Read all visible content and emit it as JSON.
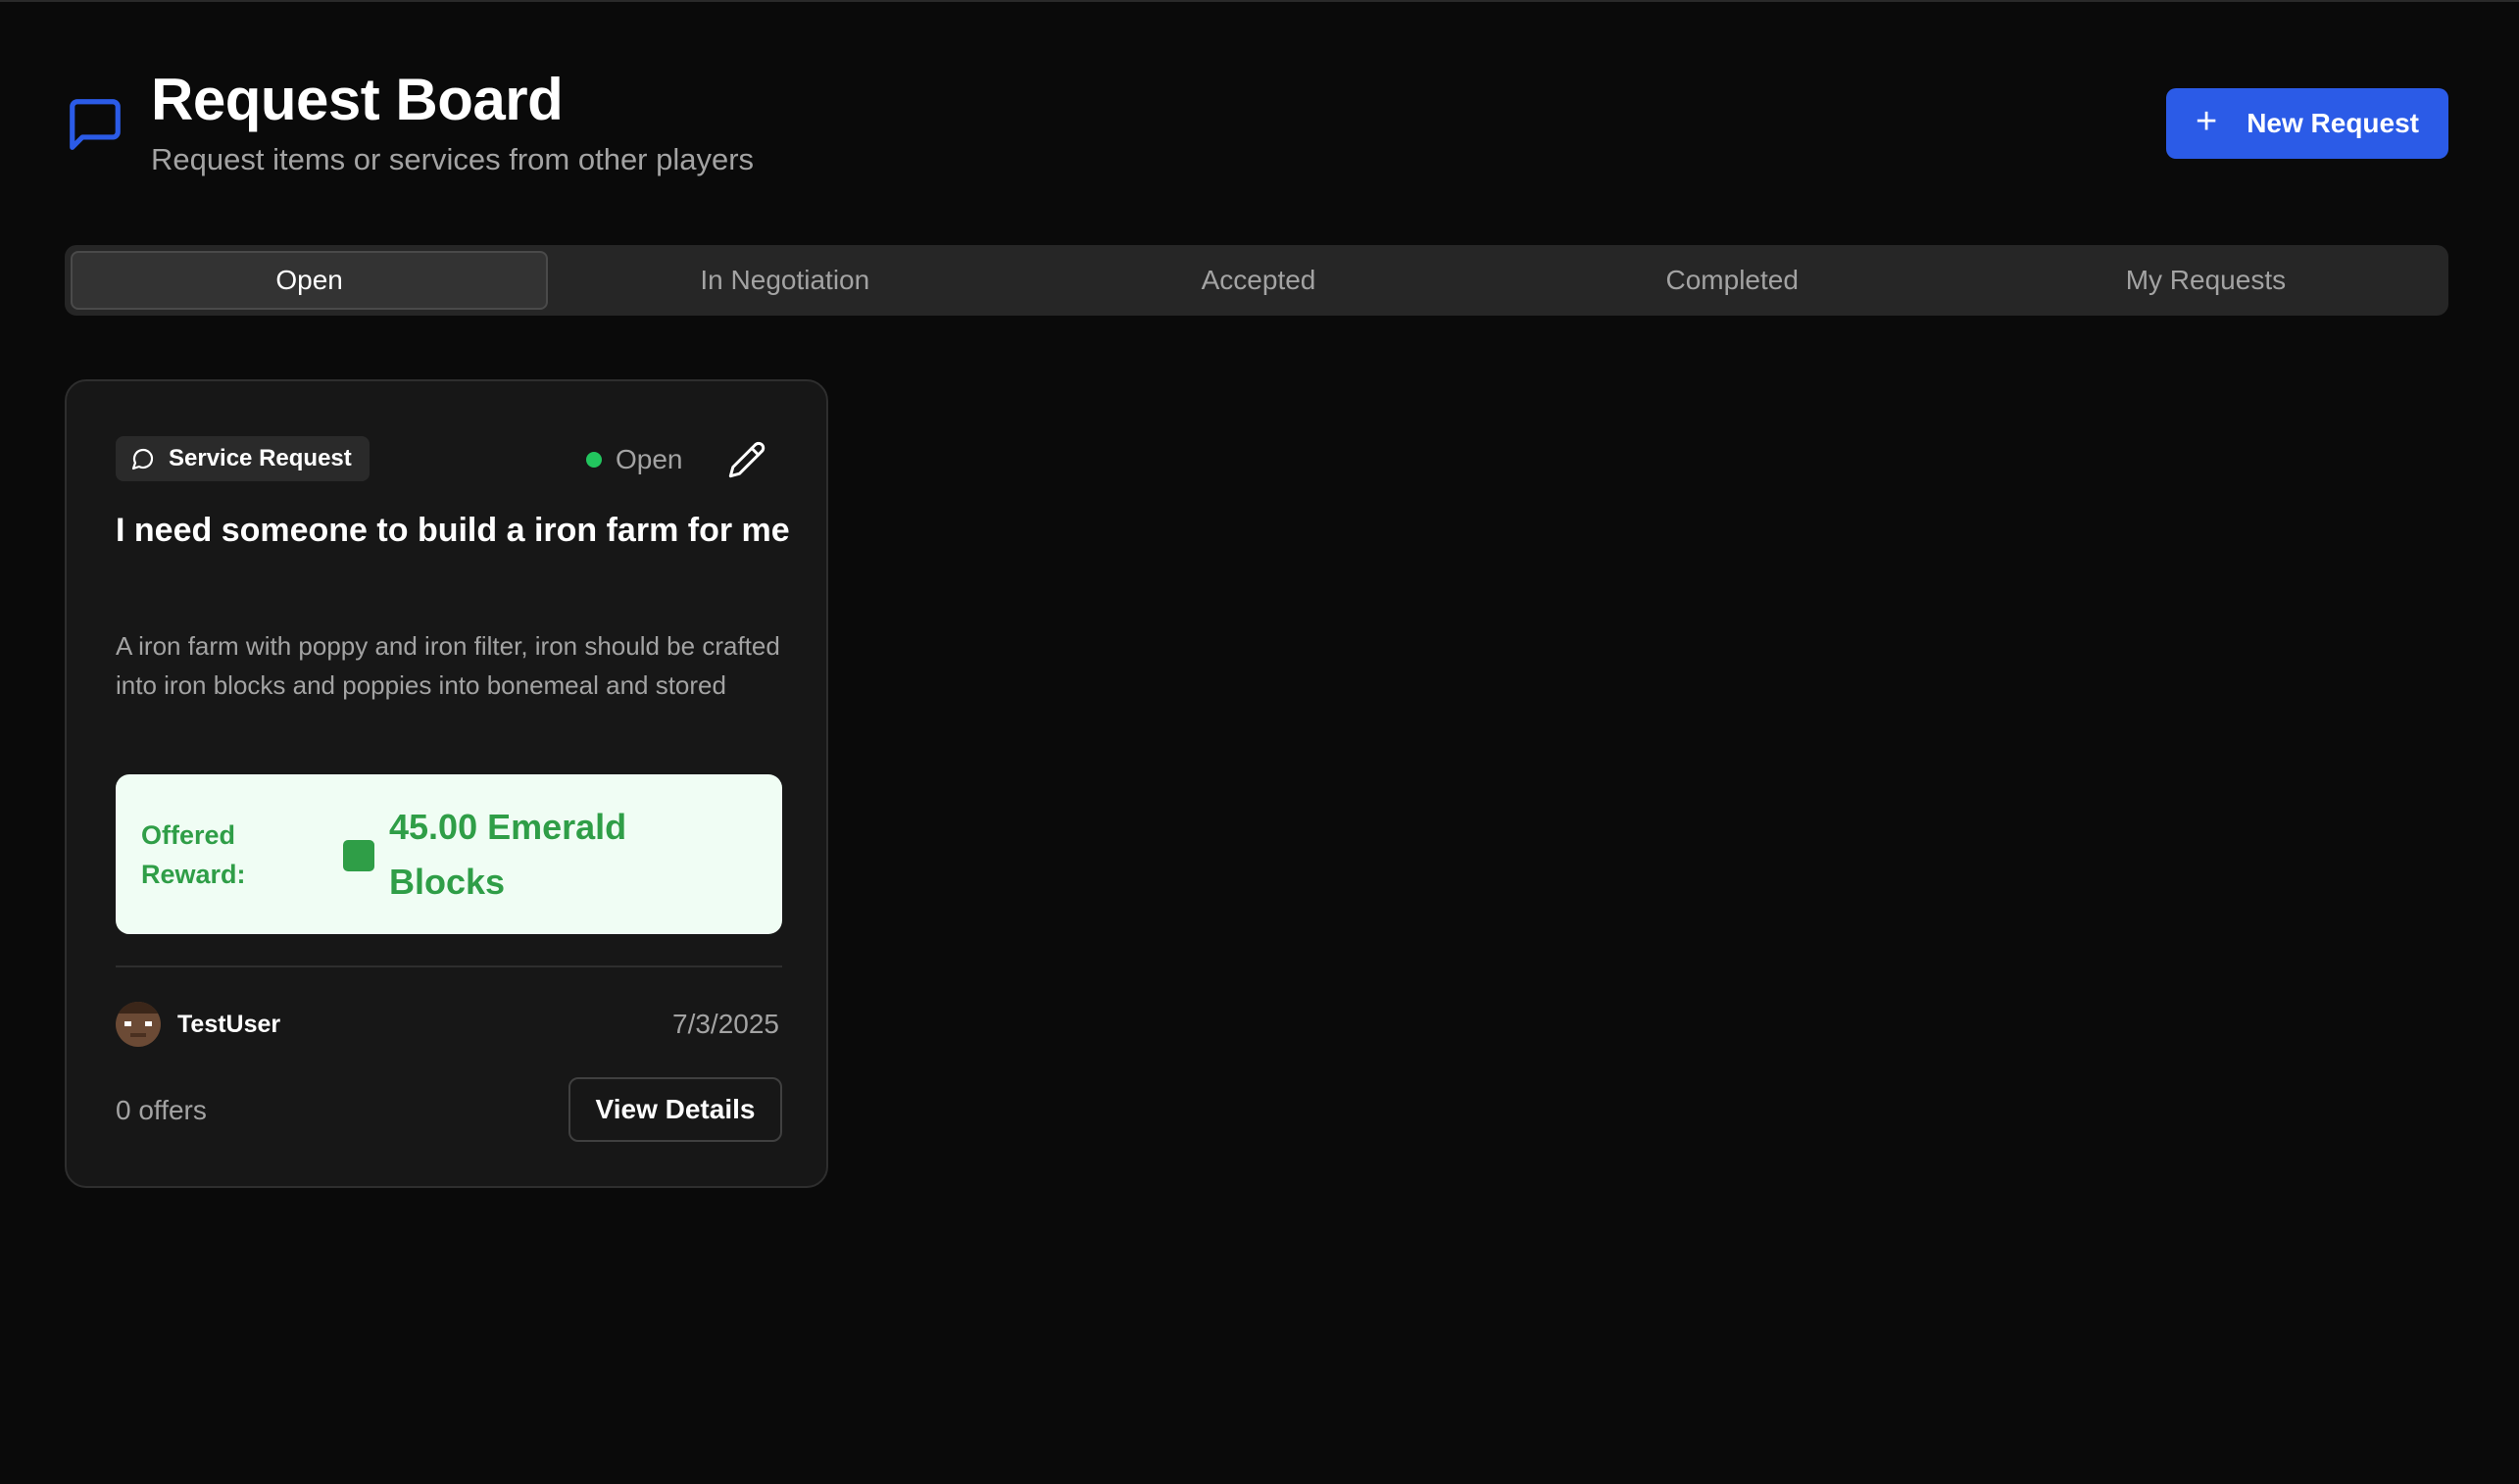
{
  "header": {
    "title": "Request Board",
    "subtitle": "Request items or services from other players",
    "icon": "message-square-icon",
    "new_button_label": "New Request"
  },
  "tabs": [
    {
      "label": "Open",
      "active": true
    },
    {
      "label": "In Negotiation",
      "active": false
    },
    {
      "label": "Accepted",
      "active": false
    },
    {
      "label": "Completed",
      "active": false
    },
    {
      "label": "My Requests",
      "active": false
    }
  ],
  "requests": [
    {
      "type_label": "Service Request",
      "status": "Open",
      "title": "I need someone to build a iron farm for me",
      "description": "A iron farm with poppy and iron filter, iron should be crafted into iron blocks and poppies into bonemeal and stored",
      "reward_label": "Offered Reward:",
      "reward_value": "45.00 Emerald Blocks",
      "user": "TestUser",
      "date": "7/3/2025",
      "offers": "0 offers",
      "view_label": "View Details"
    }
  ],
  "colors": {
    "background": "#0a0a0a",
    "accent": "#2b5be7",
    "status_open": "#22c55e",
    "reward_bg": "#f0fdf4",
    "reward_text": "#2f9e47"
  }
}
